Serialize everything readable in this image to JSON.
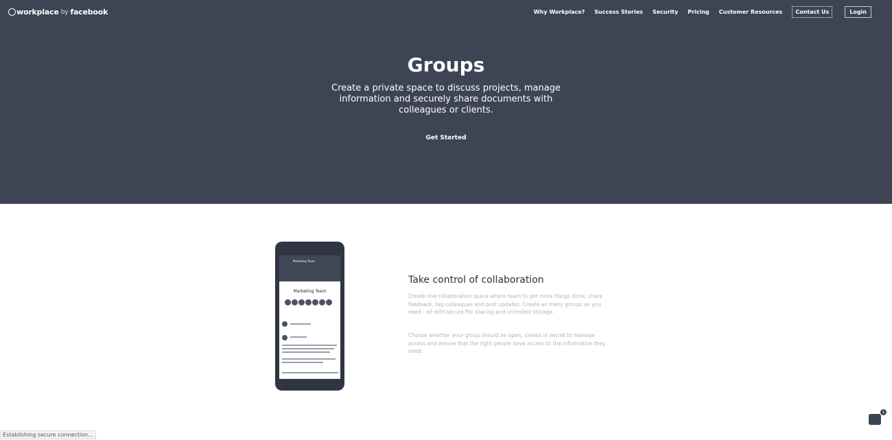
{
  "header": {
    "logo_main": "workplace",
    "logo_by": "by",
    "logo_brand": "facebook",
    "nav": [
      {
        "label": "Why Workplace?"
      },
      {
        "label": "Success Stories"
      },
      {
        "label": "Security"
      },
      {
        "label": "Pricing"
      },
      {
        "label": "Customer Resources"
      },
      {
        "label": "Contact Us"
      },
      {
        "label": "Login"
      }
    ]
  },
  "hero": {
    "title": "Groups",
    "subtitle": "Create a private space to discuss projects, manage information and securely share documents with colleagues or clients.",
    "cta": "Get Started",
    "background_color": "#3d4454"
  },
  "phone": {
    "group_name": "Marketing Team",
    "header_text": "Marketing Team"
  },
  "content": {
    "title": "Take control of collaboration",
    "paragraph1": "Create one collaboration space where team to get more things done, share feedback, tag colleagues and post updates. Create as many groups as you need - all with secure file sharing and unlimited storage.",
    "paragraph2": "Choose whether your group should be open, closed or secret to manage access and ensure that the right people have access to the information they need."
  },
  "status": {
    "text": "Establishing secure connection..."
  },
  "chat": {
    "badge": "1"
  }
}
